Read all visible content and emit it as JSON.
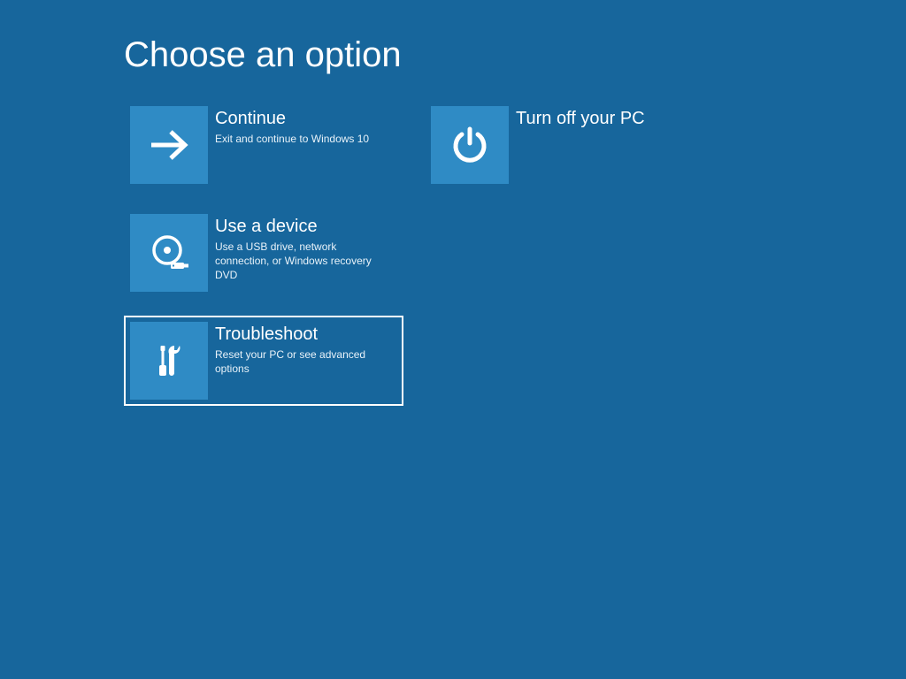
{
  "title": "Choose an option",
  "options": {
    "continue": {
      "title": "Continue",
      "desc": "Exit and continue to Windows 10"
    },
    "use_device": {
      "title": "Use a device",
      "desc": "Use a USB drive, network connection, or Windows recovery DVD"
    },
    "troubleshoot": {
      "title": "Troubleshoot",
      "desc": "Reset your PC or see advanced options"
    },
    "turn_off": {
      "title": "Turn off your PC",
      "desc": ""
    }
  },
  "colors": {
    "background": "#17669c",
    "tile_icon_bg": "#2f8bc5",
    "selection_border": "#ffffff"
  },
  "selected": "troubleshoot"
}
